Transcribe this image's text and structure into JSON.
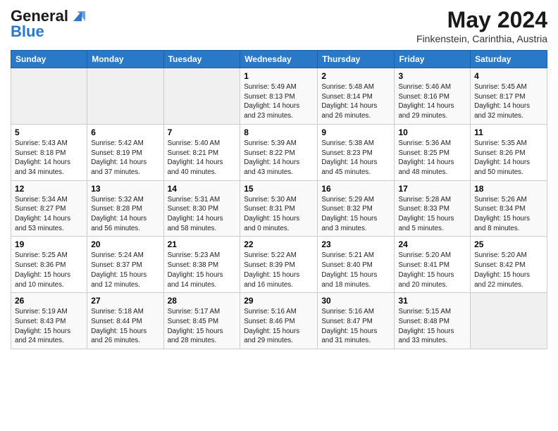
{
  "header": {
    "logo_general": "General",
    "logo_blue": "Blue",
    "title": "May 2024",
    "subtitle": "Finkenstein, Carinthia, Austria"
  },
  "calendar": {
    "days_of_week": [
      "Sunday",
      "Monday",
      "Tuesday",
      "Wednesday",
      "Thursday",
      "Friday",
      "Saturday"
    ],
    "weeks": [
      [
        {
          "day": "",
          "info": ""
        },
        {
          "day": "",
          "info": ""
        },
        {
          "day": "",
          "info": ""
        },
        {
          "day": "1",
          "info": "Sunrise: 5:49 AM\nSunset: 8:13 PM\nDaylight: 14 hours\nand 23 minutes."
        },
        {
          "day": "2",
          "info": "Sunrise: 5:48 AM\nSunset: 8:14 PM\nDaylight: 14 hours\nand 26 minutes."
        },
        {
          "day": "3",
          "info": "Sunrise: 5:46 AM\nSunset: 8:16 PM\nDaylight: 14 hours\nand 29 minutes."
        },
        {
          "day": "4",
          "info": "Sunrise: 5:45 AM\nSunset: 8:17 PM\nDaylight: 14 hours\nand 32 minutes."
        }
      ],
      [
        {
          "day": "5",
          "info": "Sunrise: 5:43 AM\nSunset: 8:18 PM\nDaylight: 14 hours\nand 34 minutes."
        },
        {
          "day": "6",
          "info": "Sunrise: 5:42 AM\nSunset: 8:19 PM\nDaylight: 14 hours\nand 37 minutes."
        },
        {
          "day": "7",
          "info": "Sunrise: 5:40 AM\nSunset: 8:21 PM\nDaylight: 14 hours\nand 40 minutes."
        },
        {
          "day": "8",
          "info": "Sunrise: 5:39 AM\nSunset: 8:22 PM\nDaylight: 14 hours\nand 43 minutes."
        },
        {
          "day": "9",
          "info": "Sunrise: 5:38 AM\nSunset: 8:23 PM\nDaylight: 14 hours\nand 45 minutes."
        },
        {
          "day": "10",
          "info": "Sunrise: 5:36 AM\nSunset: 8:25 PM\nDaylight: 14 hours\nand 48 minutes."
        },
        {
          "day": "11",
          "info": "Sunrise: 5:35 AM\nSunset: 8:26 PM\nDaylight: 14 hours\nand 50 minutes."
        }
      ],
      [
        {
          "day": "12",
          "info": "Sunrise: 5:34 AM\nSunset: 8:27 PM\nDaylight: 14 hours\nand 53 minutes."
        },
        {
          "day": "13",
          "info": "Sunrise: 5:32 AM\nSunset: 8:28 PM\nDaylight: 14 hours\nand 56 minutes."
        },
        {
          "day": "14",
          "info": "Sunrise: 5:31 AM\nSunset: 8:30 PM\nDaylight: 14 hours\nand 58 minutes."
        },
        {
          "day": "15",
          "info": "Sunrise: 5:30 AM\nSunset: 8:31 PM\nDaylight: 15 hours\nand 0 minutes."
        },
        {
          "day": "16",
          "info": "Sunrise: 5:29 AM\nSunset: 8:32 PM\nDaylight: 15 hours\nand 3 minutes."
        },
        {
          "day": "17",
          "info": "Sunrise: 5:28 AM\nSunset: 8:33 PM\nDaylight: 15 hours\nand 5 minutes."
        },
        {
          "day": "18",
          "info": "Sunrise: 5:26 AM\nSunset: 8:34 PM\nDaylight: 15 hours\nand 8 minutes."
        }
      ],
      [
        {
          "day": "19",
          "info": "Sunrise: 5:25 AM\nSunset: 8:36 PM\nDaylight: 15 hours\nand 10 minutes."
        },
        {
          "day": "20",
          "info": "Sunrise: 5:24 AM\nSunset: 8:37 PM\nDaylight: 15 hours\nand 12 minutes."
        },
        {
          "day": "21",
          "info": "Sunrise: 5:23 AM\nSunset: 8:38 PM\nDaylight: 15 hours\nand 14 minutes."
        },
        {
          "day": "22",
          "info": "Sunrise: 5:22 AM\nSunset: 8:39 PM\nDaylight: 15 hours\nand 16 minutes."
        },
        {
          "day": "23",
          "info": "Sunrise: 5:21 AM\nSunset: 8:40 PM\nDaylight: 15 hours\nand 18 minutes."
        },
        {
          "day": "24",
          "info": "Sunrise: 5:20 AM\nSunset: 8:41 PM\nDaylight: 15 hours\nand 20 minutes."
        },
        {
          "day": "25",
          "info": "Sunrise: 5:20 AM\nSunset: 8:42 PM\nDaylight: 15 hours\nand 22 minutes."
        }
      ],
      [
        {
          "day": "26",
          "info": "Sunrise: 5:19 AM\nSunset: 8:43 PM\nDaylight: 15 hours\nand 24 minutes."
        },
        {
          "day": "27",
          "info": "Sunrise: 5:18 AM\nSunset: 8:44 PM\nDaylight: 15 hours\nand 26 minutes."
        },
        {
          "day": "28",
          "info": "Sunrise: 5:17 AM\nSunset: 8:45 PM\nDaylight: 15 hours\nand 28 minutes."
        },
        {
          "day": "29",
          "info": "Sunrise: 5:16 AM\nSunset: 8:46 PM\nDaylight: 15 hours\nand 29 minutes."
        },
        {
          "day": "30",
          "info": "Sunrise: 5:16 AM\nSunset: 8:47 PM\nDaylight: 15 hours\nand 31 minutes."
        },
        {
          "day": "31",
          "info": "Sunrise: 5:15 AM\nSunset: 8:48 PM\nDaylight: 15 hours\nand 33 minutes."
        },
        {
          "day": "",
          "info": ""
        }
      ]
    ]
  }
}
